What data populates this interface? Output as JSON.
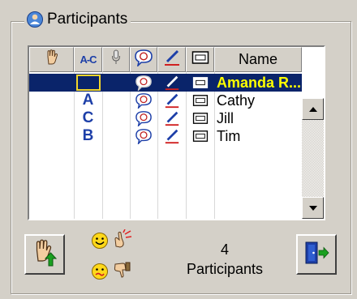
{
  "group": {
    "title": "Participants"
  },
  "list": {
    "columns": [
      {
        "key": "raise_hand",
        "icon": "raise-hand-icon"
      },
      {
        "key": "az_sort",
        "label": "A-C"
      },
      {
        "key": "microphone",
        "icon": "microphone-icon"
      },
      {
        "key": "chat",
        "icon": "chat-bubble-icon"
      },
      {
        "key": "annotate",
        "icon": "pen-icon"
      },
      {
        "key": "video",
        "icon": "video-screen-icon"
      },
      {
        "key": "name",
        "label": "Name"
      }
    ],
    "rows": [
      {
        "mark": "",
        "name": "Amanda R...",
        "selected": true
      },
      {
        "mark": "A",
        "name": "Cathy",
        "selected": false
      },
      {
        "mark": "C",
        "name": "Jill",
        "selected": false
      },
      {
        "mark": "B",
        "name": "Tim",
        "selected": false
      }
    ]
  },
  "footer": {
    "count": "4",
    "count_label": "Participants",
    "left_button_icon": "raise-hand-up-icon",
    "right_button_icon": "exit-door-icon",
    "emotes": [
      "smiley-happy-icon",
      "applause-icon",
      "smiley-confused-icon",
      "thumbs-down-icon"
    ]
  },
  "colors": {
    "selection": "#0a246a",
    "selected_text": "#ffff00",
    "mark_letters": "#1d3fa8",
    "face": "#d4d0c8"
  }
}
